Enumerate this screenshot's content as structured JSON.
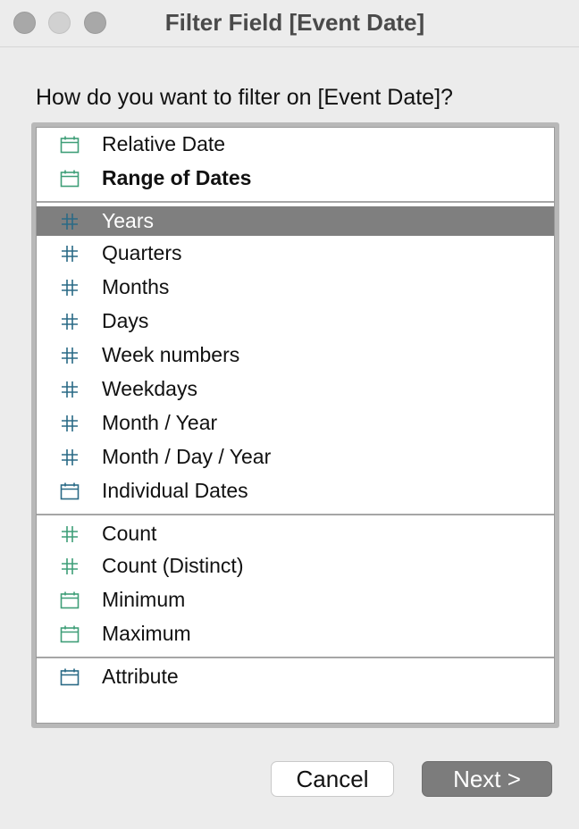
{
  "window": {
    "title": "Filter Field [Event Date]"
  },
  "dialog": {
    "question": "How do you want to filter on [Event Date]?"
  },
  "colors": {
    "green": "#3f9e78",
    "teal": "#2a6a86",
    "selected_bg": "#7f7f7f"
  },
  "list": {
    "items": [
      {
        "label": "Relative Date",
        "icon": "calendar-icon",
        "color": "green",
        "bold": false,
        "selected": false
      },
      {
        "label": "Range of Dates",
        "icon": "calendar-icon",
        "color": "green",
        "bold": true,
        "selected": false
      },
      {
        "label": "Years",
        "icon": "hash-icon",
        "color": "teal",
        "bold": false,
        "selected": true
      },
      {
        "label": "Quarters",
        "icon": "hash-icon",
        "color": "teal",
        "bold": false,
        "selected": false
      },
      {
        "label": "Months",
        "icon": "hash-icon",
        "color": "teal",
        "bold": false,
        "selected": false
      },
      {
        "label": "Days",
        "icon": "hash-icon",
        "color": "teal",
        "bold": false,
        "selected": false
      },
      {
        "label": "Week numbers",
        "icon": "hash-icon",
        "color": "teal",
        "bold": false,
        "selected": false
      },
      {
        "label": "Weekdays",
        "icon": "hash-icon",
        "color": "teal",
        "bold": false,
        "selected": false
      },
      {
        "label": "Month / Year",
        "icon": "hash-icon",
        "color": "teal",
        "bold": false,
        "selected": false
      },
      {
        "label": "Month / Day / Year",
        "icon": "hash-icon",
        "color": "teal",
        "bold": false,
        "selected": false
      },
      {
        "label": "Individual Dates",
        "icon": "calendar-icon",
        "color": "teal",
        "bold": false,
        "selected": false
      },
      {
        "label": "Count",
        "icon": "hash-icon",
        "color": "green",
        "bold": false,
        "selected": false
      },
      {
        "label": "Count (Distinct)",
        "icon": "hash-icon",
        "color": "green",
        "bold": false,
        "selected": false
      },
      {
        "label": "Minimum",
        "icon": "calendar-icon",
        "color": "green",
        "bold": false,
        "selected": false
      },
      {
        "label": "Maximum",
        "icon": "calendar-icon",
        "color": "green",
        "bold": false,
        "selected": false
      },
      {
        "label": "Attribute",
        "icon": "calendar-icon",
        "color": "teal",
        "bold": false,
        "selected": false
      }
    ]
  },
  "buttons": {
    "cancel_label": "Cancel",
    "next_label": "Next >"
  }
}
